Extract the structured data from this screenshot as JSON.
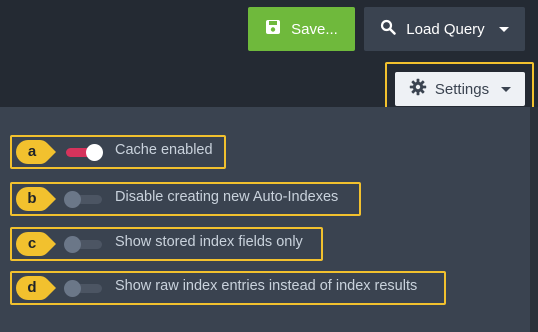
{
  "toolbar": {
    "save_label": "Save...",
    "load_query_label": "Load Query",
    "settings_label": "Settings"
  },
  "settings": {
    "items": [
      {
        "marker": "a",
        "label": "Cache enabled",
        "enabled": true
      },
      {
        "marker": "b",
        "label": "Disable creating new Auto-Indexes",
        "enabled": false
      },
      {
        "marker": "c",
        "label": "Show stored index fields only",
        "enabled": false
      },
      {
        "marker": "d",
        "label": "Show raw index entries instead of index results",
        "enabled": false
      }
    ]
  },
  "colors": {
    "accent_save": "#6fb93c",
    "highlight": "#f2c12e",
    "toggle_on": "#d6335c"
  }
}
